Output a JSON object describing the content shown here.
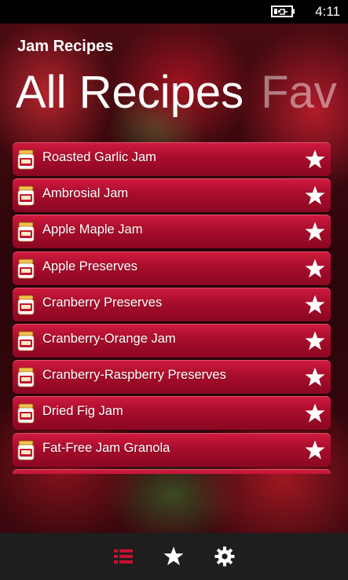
{
  "status_bar": {
    "time": "4:11",
    "battery_icon": "battery-charging-icon"
  },
  "app": {
    "title": "Jam Recipes"
  },
  "pivot": {
    "active": "All Recipes",
    "next": "Fav"
  },
  "recipes": [
    {
      "name": "Roasted Garlic Jam"
    },
    {
      "name": "Ambrosial Jam"
    },
    {
      "name": "Apple Maple Jam"
    },
    {
      "name": "Apple Preserves"
    },
    {
      "name": "Cranberry Preserves"
    },
    {
      "name": "Cranberry-Orange Jam"
    },
    {
      "name": "Cranberry-Raspberry Preserves"
    },
    {
      "name": "Dried Fig Jam"
    },
    {
      "name": "Fat-Free Jam Granola"
    }
  ],
  "app_bar": {
    "buttons": [
      {
        "icon": "list-icon",
        "active": true
      },
      {
        "icon": "star-icon",
        "active": false
      },
      {
        "icon": "gear-icon",
        "active": false
      }
    ]
  },
  "colors": {
    "accent": "#c0102f",
    "row_top": "#d11a3f",
    "row_bottom": "#8a0722",
    "appbar_bg": "#1e1e1e",
    "active_icon": "#c8102e"
  }
}
